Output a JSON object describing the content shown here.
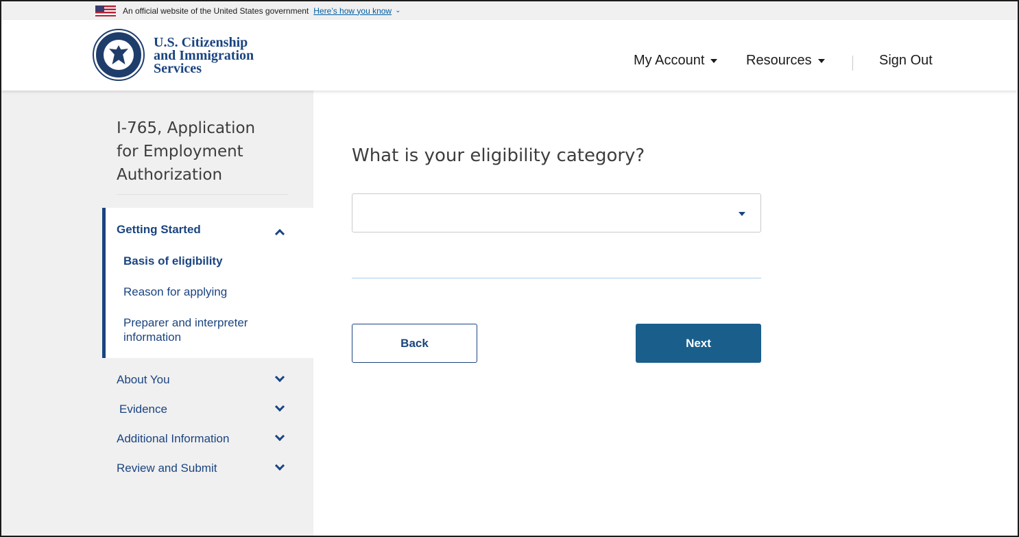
{
  "gov_banner": {
    "text": "An official website of the United States government",
    "link": "Here’s how you know",
    "chevron": "⌄",
    "flag_icon": "us-flag-icon"
  },
  "header": {
    "seal_icon": "dhs-seal-icon",
    "agency_line1": "U.S. Citizenship",
    "agency_line2": "and Immigration",
    "agency_line3": "Services",
    "nav": {
      "my_account": "My Account",
      "resources": "Resources",
      "sign_out": "Sign Out"
    }
  },
  "sidebar": {
    "title": "I-765, Application for Employment Authorization",
    "active_section": {
      "label": "Getting Started",
      "items": [
        {
          "label": "Basis of eligibility",
          "current": true
        },
        {
          "label": "Reason for applying",
          "current": false
        },
        {
          "label": "Preparer and interpreter information",
          "current": false
        }
      ]
    },
    "sections": [
      {
        "label": "About You"
      },
      {
        "label": "Evidence"
      },
      {
        "label": "Additional Information"
      },
      {
        "label": "Review and Submit"
      }
    ]
  },
  "main": {
    "question": "What is your eligibility category?",
    "select": {
      "value": ""
    },
    "buttons": {
      "back": "Back",
      "next": "Next"
    }
  },
  "colors": {
    "primary": "#1a4480",
    "next_button": "#1a5e8c",
    "sidebar_bg": "#f0f0f0"
  }
}
